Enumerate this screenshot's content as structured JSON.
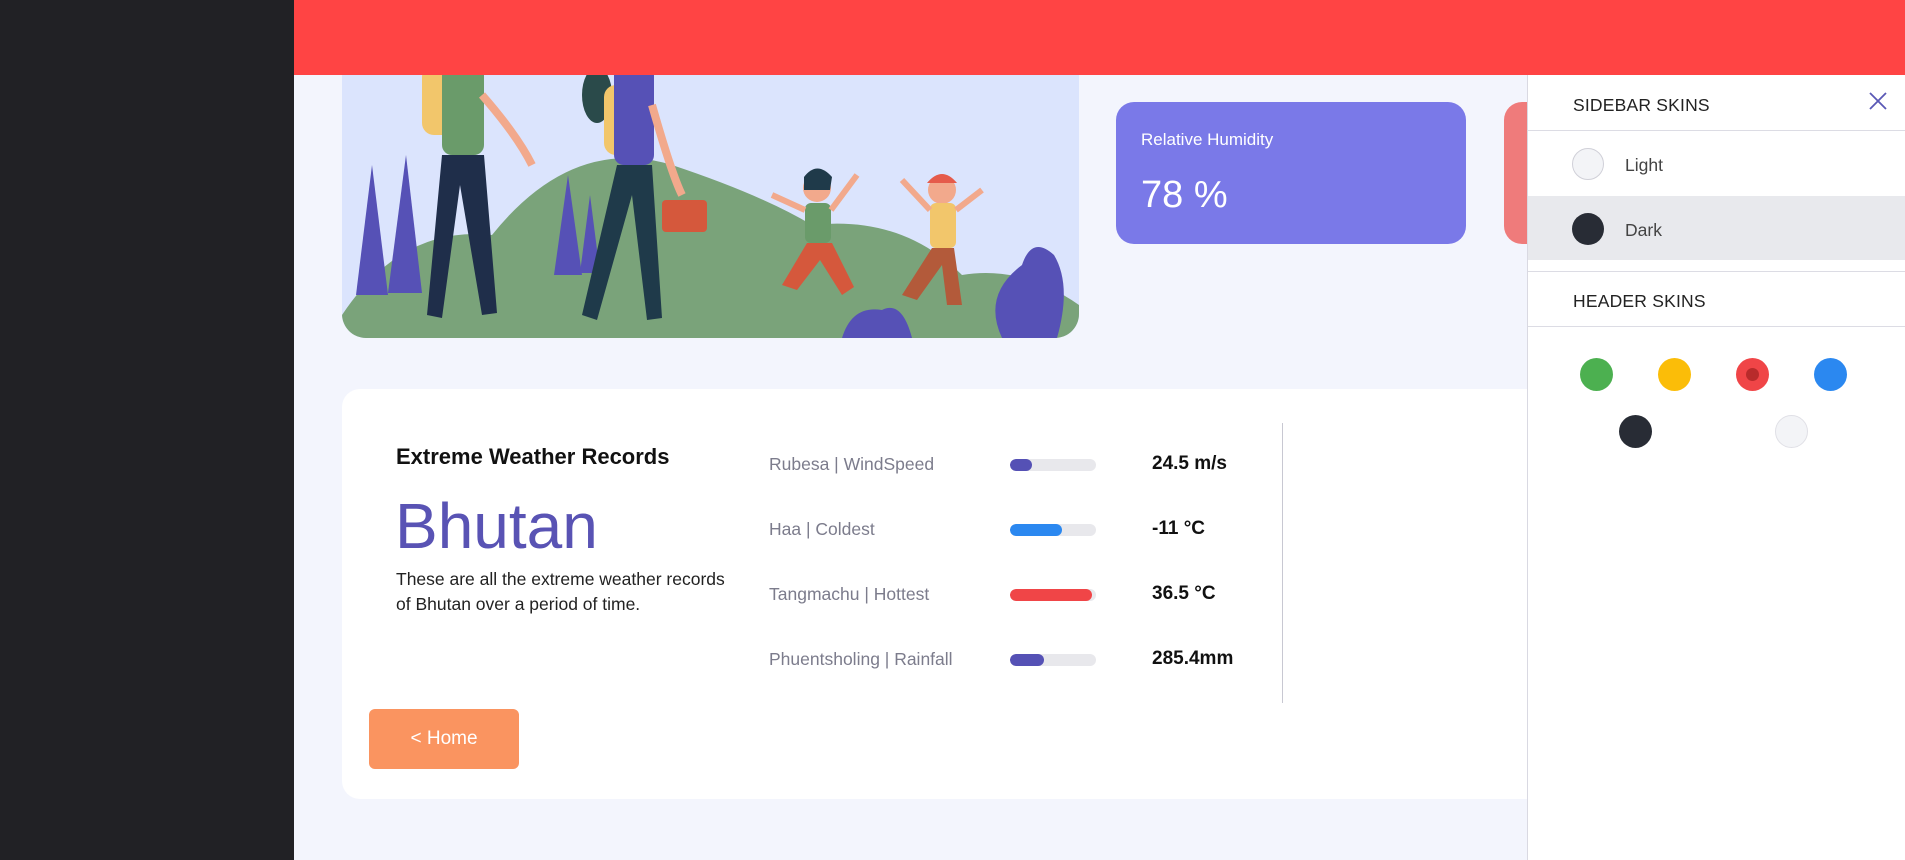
{
  "header": {
    "menu_icon": "hamburger-menu-icon",
    "color": "#ff4444"
  },
  "sidebar": {
    "color": "#212125"
  },
  "humidity_card": {
    "label": "Relative Humidity",
    "value": "78 %",
    "color": "#7a79e8"
  },
  "records": {
    "title": "Extreme Weather Records",
    "country": "Bhutan",
    "description": "These are all the extreme weather records of Bhutan over a period of time.",
    "items": [
      {
        "label": "Rubesa | WindSpeed",
        "value": "24.5 m/s",
        "level": 0.25,
        "color": "#5551b5"
      },
      {
        "label": "Haa | Coldest",
        "value": "-11 °C",
        "level": 0.6,
        "color": "#2b88f0"
      },
      {
        "label": "Tangmachu | Hottest",
        "value": "36.5 °C",
        "level": 0.95,
        "color": "#f04547"
      },
      {
        "label": "Phuentsholing | Rainfall",
        "value": "285.4mm",
        "level": 0.4,
        "color": "#5551b5"
      }
    ],
    "home_button": "< Home"
  },
  "skin_panel": {
    "sidebar_skins_title": "SIDEBAR SKINS",
    "close_icon": "close-icon",
    "sidebar_skins": [
      {
        "label": "Light",
        "color": "#f3f4f7",
        "selected": false
      },
      {
        "label": "Dark",
        "color": "#282c35",
        "selected": true
      }
    ],
    "header_skins_title": "HEADER SKINS",
    "header_skins": [
      {
        "name": "green",
        "color": "#4cb050",
        "selected": false
      },
      {
        "name": "yellow",
        "color": "#fbbd08",
        "selected": false
      },
      {
        "name": "red",
        "color": "#f04547",
        "selected": true
      },
      {
        "name": "blue",
        "color": "#2b88f0",
        "selected": false
      },
      {
        "name": "dark",
        "color": "#282c35",
        "selected": false
      },
      {
        "name": "light",
        "color": "#f3f4f7",
        "selected": false
      }
    ]
  }
}
